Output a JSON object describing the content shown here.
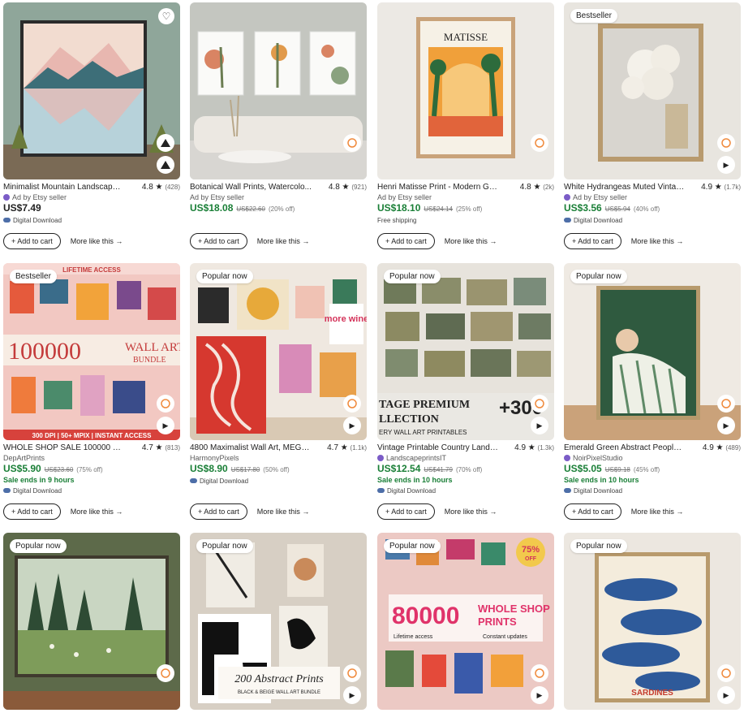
{
  "add_to_cart_label": "Add to cart",
  "more_like_label": "More like this",
  "products": [
    {
      "title": "Minimalist Mountain Landscape ...",
      "rating": "4.8",
      "reviews": "(428)",
      "sub": "Ad by Etsy seller",
      "price": "US$7.49",
      "extra": "Digital Download"
    },
    {
      "title": "Botanical Wall Prints, Watercolo...",
      "rating": "4.8",
      "reviews": "(921)",
      "sub": "Ad by Etsy seller",
      "price": "US$18.08",
      "orig": "US$22.60",
      "pct": "(20% off)"
    },
    {
      "title": "Henri Matisse Print - Modern Gal...",
      "rating": "4.8",
      "reviews": "(2k)",
      "sub": "Ad by Etsy seller",
      "price": "US$18.10",
      "orig": "US$24.14",
      "pct": "(25% off)",
      "extra": "Free shipping"
    },
    {
      "title": "White Hydrangeas Muted Vintag...",
      "rating": "4.9",
      "reviews": "(1.7k)",
      "sub": "Ad by Etsy seller",
      "price": "US$3.56",
      "orig": "US$5.94",
      "pct": "(40% off)",
      "extra": "Digital Download",
      "badge": "Bestseller"
    },
    {
      "title": "WHOLE SHOP SALE 100000 Me...",
      "rating": "4.7",
      "reviews": "(813)",
      "sub": "DepArtPrints",
      "price": "US$5.90",
      "orig": "US$23.60",
      "pct": "(75% off)",
      "sale_end": "Sale ends in 9 hours",
      "extra": "Digital Download",
      "badge": "Bestseller"
    },
    {
      "title": "4800 Maximalist Wall Art, MEGA...",
      "rating": "4.7",
      "reviews": "(1.1k)",
      "sub": "HarmonyPixels",
      "price": "US$8.90",
      "orig": "US$17.80",
      "pct": "(50% off)",
      "extra": "Digital Download",
      "badge": "Popular now"
    },
    {
      "title": "Vintage Printable Country Lands...",
      "rating": "4.9",
      "reviews": "(1.3k)",
      "sub": "LandscapeprintsIT",
      "price": "US$12.54",
      "orig": "US$41.79",
      "pct": "(70% off)",
      "sale_end": "Sale ends in 10 hours",
      "extra": "Digital Download",
      "badge": "Popular now"
    },
    {
      "title": "Emerald Green Abstract People ...",
      "rating": "4.9",
      "reviews": "(489)",
      "sub": "NoirPixelStudio",
      "price": "US$5.05",
      "orig": "US$9.18",
      "pct": "(45% off)",
      "sale_end": "Sale ends in 10 hours",
      "extra": "Digital Download",
      "badge": "Popular now"
    },
    {
      "badge": "Popular now"
    },
    {
      "badge": "Popular now"
    },
    {
      "badge": "Popular now"
    },
    {
      "badge": "Popular now"
    }
  ],
  "image_text": {
    "matisse": "MATISSE",
    "bundle_top": "LIFETIME ACCESS",
    "bundle_big": "100000",
    "bundle_wall": "WALL ART",
    "bundle_word": "BUNDLE",
    "bundle_bottom": "300 DPI | 50+ MPIX | INSTANT ACCESS",
    "more_wine": "more wine",
    "vintage_line1": "TAGE PREMIUM",
    "vintage_line2": "LLECTION",
    "vintage_line3": "ERY WALL ART PRINTABLES",
    "vintage_num": "+300",
    "abstract_title": "200 Abstract Prints",
    "abstract_sub": "BLACK & BEIGE WALL ART BUNDLE",
    "promo_pct": "75%",
    "promo_off": "OFF",
    "promo_big": "80000",
    "promo_whole": "WHOLE SHOP",
    "promo_prints": "PRINTS",
    "promo_life": "Lifetime access",
    "promo_updates": "Constant updates",
    "sardines": "SARDINES"
  }
}
